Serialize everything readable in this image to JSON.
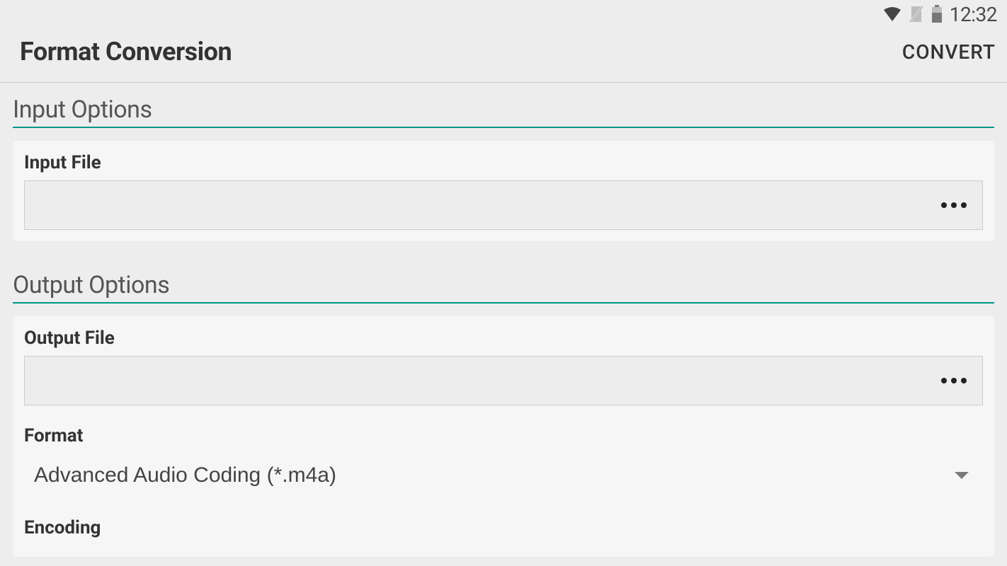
{
  "status_bar": {
    "time": "12:32"
  },
  "app_bar": {
    "title": "Format Conversion",
    "convert_label": "CONVERT"
  },
  "input_options": {
    "section_title": "Input Options",
    "input_file_label": "Input File",
    "input_file_value": ""
  },
  "output_options": {
    "section_title": "Output Options",
    "output_file_label": "Output File",
    "output_file_value": "",
    "format_label": "Format",
    "format_value": "Advanced Audio Coding (*.m4a)",
    "encoding_label": "Encoding"
  }
}
